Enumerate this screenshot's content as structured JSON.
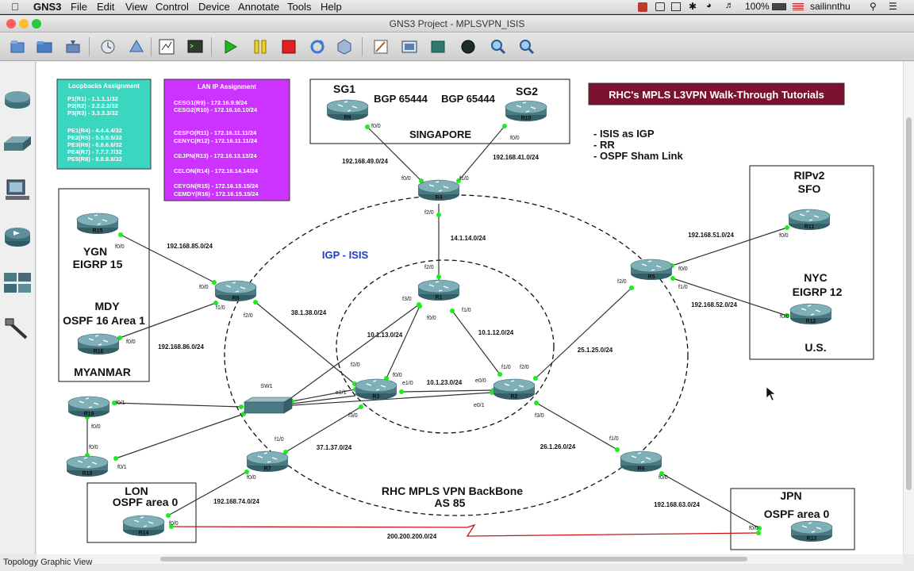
{
  "menubar": {
    "apple": "",
    "app": "GNS3",
    "items": [
      "File",
      "Edit",
      "View",
      "Control",
      "Device",
      "Annotate",
      "Tools",
      "Help"
    ],
    "battery": "100%",
    "user": "sailinnthu"
  },
  "window": {
    "title": "GNS3 Project - MPLSVPN_ISIS"
  },
  "toolbar": [
    "new-project",
    "open-project",
    "save-project",
    "snapshot",
    "console-all",
    "topology-summary",
    "terminal",
    "start-all",
    "suspend-all",
    "stop-all",
    "reload-all",
    "virtualbox",
    "add-note",
    "screenshot",
    "draw-rectangle",
    "draw-ellipse",
    "zoom-in",
    "zoom-out"
  ],
  "sidebar": [
    "router",
    "switch",
    "end-device",
    "security-device",
    "all-devices",
    "link-tool"
  ],
  "status": {
    "text": "Topology Graphic View"
  },
  "colors": {
    "router": "#4a7a82",
    "link_up": "#1aee1a",
    "wan_link": "#cc1111",
    "lan_box": "#cc33ff",
    "loop_box": "#3ad6c0",
    "title_box": "#7a1230"
  },
  "topology": {
    "loopbacks": {
      "title": "Loopbacks Assignment",
      "lines": [
        "P1(R1)    - 1.1.1.1/32",
        "P2(R2)    - 2.2.2.2/32",
        "P3(R3)    - 3.3.3.3/32",
        "",
        "PE1(R4) - 4.4.4.4/32",
        "PE2(R5) - 5.5.5.5/32",
        "PE3(R6) - 6.6.6.6/32",
        "PE4(R7) - 7.7.7.7/32",
        "PE5(R8) - 8.8.8.8/32"
      ]
    },
    "lan": {
      "title": "LAN IP Assignment",
      "lines": [
        "CESG1(R9)   - 172.16.9.9/24",
        "CESG2(R10) - 172.16.10.10/24",
        "",
        "CESFO(R11) - 172.16.11.11/24",
        "CENYC(R12) - 172.16.11.11/24",
        "",
        "CEJPN(R13) - 172.16.13.13/24",
        "",
        "CELON(R14) - 172.16.14.14/24",
        "",
        "CEYGN(R15) - 172.16.15.15/24",
        "CEMDY(R16) - 172.16.15.15/24"
      ]
    },
    "banner": "RHC's MPLS L3VPN Walk-Through Tutorials",
    "features": [
      "- ISIS as IGP",
      "- RR",
      "- OSPF Sham Link"
    ],
    "igp": "IGP - ISIS",
    "backbone": [
      "RHC MPLS VPN BackBone",
      "AS 85"
    ],
    "sites": {
      "singapore": {
        "sg1": "SG1",
        "sg2": "SG2",
        "bgp1": "BGP 65444",
        "bgp2": "BGP 65444",
        "name": "SINGAPORE"
      },
      "myanmar": {
        "ygn": "YGN",
        "eigrp": "EIGRP 15",
        "mdy": "MDY",
        "ospf": "OSPF 16 Area 1",
        "name": "MYANMAR"
      },
      "us": {
        "rip": "RIPv2",
        "sfo": "SFO",
        "nyc": "NYC",
        "eigrp": "EIGRP 12",
        "name": "U.S."
      },
      "lon": {
        "name": "LON",
        "ospf": "OSPF area 0"
      },
      "jpn": {
        "name": "JPN",
        "ospf": "OSPF area 0"
      }
    },
    "routers": [
      "R1",
      "R2",
      "R3",
      "R4",
      "R5",
      "R6",
      "R7",
      "R8",
      "R9",
      "R10",
      "R11",
      "R12",
      "R13",
      "R14",
      "R15",
      "R16",
      "R18",
      "R19"
    ],
    "switch": "SW1",
    "subnets": [
      "192.168.49.0/24",
      "192.168.41.0/24",
      "14.1.14.0/24",
      "192.168.85.0/24",
      "192.168.86.0/24",
      "38.1.38.0/24",
      "10.1.13.0/24",
      "10.1.12.0/24",
      "10.1.23.0/24",
      "192.168.51.0/24",
      "192.168.52.0/24",
      "25.1.25.0/24",
      "37.1.37.0/24",
      "26.1.26.0/24",
      "192.168.74.0/24",
      "192.168.63.0/24",
      "200.200.200.0/24"
    ],
    "ports": [
      "f0/0",
      "f1/0",
      "f2/0",
      "f3/0",
      "e0/0",
      "e0/1",
      "e1/0",
      "e1/1",
      "f0/1"
    ]
  }
}
